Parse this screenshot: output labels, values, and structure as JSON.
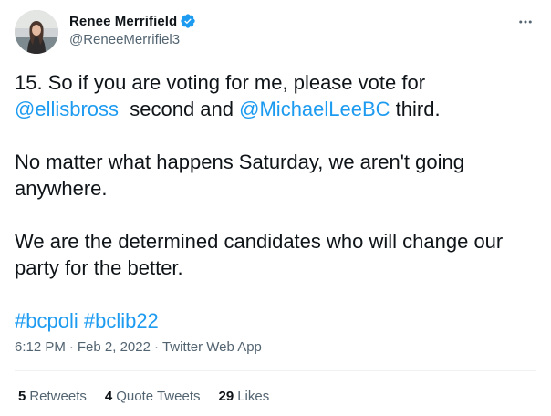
{
  "author": {
    "display_name": "Renee Merrifield",
    "handle": "@ReneeMerrifiel3",
    "verified": true
  },
  "tweet": {
    "line1_prefix": "15. So if you are voting for me, please vote for",
    "mention1": "@ellisbross",
    "between": "  second and ",
    "mention2": "@MichaelLeeBC",
    "suffix": " third.",
    "paragraph2": "No matter what happens Saturday, we aren't going anywhere.",
    "paragraph3": "We are the determined candidates who will change our party for the better.",
    "hashtag1": "#bcpoli",
    "hashtag2": "#bclib22"
  },
  "meta": {
    "time": "6:12 PM",
    "separator": "·",
    "date": "Feb 2, 2022",
    "app": "Twitter Web App"
  },
  "stats": {
    "retweets_count": "5",
    "retweets_label": "Retweets",
    "quotes_count": "4",
    "quotes_label": "Quote Tweets",
    "likes_count": "29",
    "likes_label": "Likes"
  },
  "colors": {
    "link": "#1d9bf0",
    "text": "#0f1419",
    "secondary": "#536471",
    "divider": "#eff3f4",
    "verified": "#1d9bf0"
  },
  "icons": {
    "verified": "verified-badge-icon",
    "more": "more-options-icon",
    "avatar": "profile-photo"
  }
}
